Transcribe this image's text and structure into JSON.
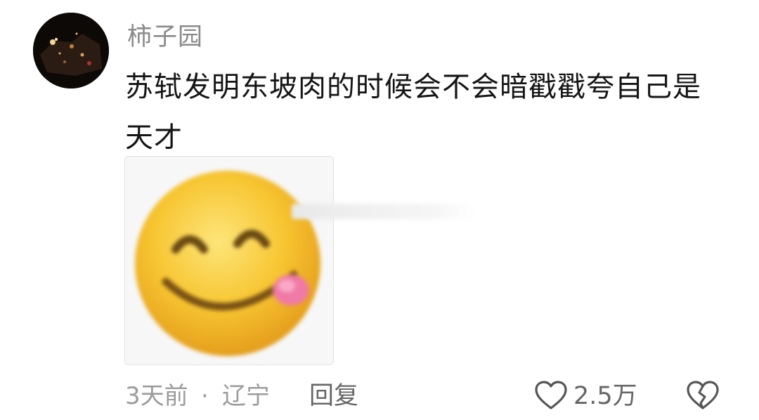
{
  "comment": {
    "username": "柿子园",
    "text": "苏轼发明东坡肉的时候会不会暗戳戳夸自己是天才",
    "sticker_icon": "tongue-out-smiley-emoji",
    "time": "3天前",
    "separator": "·",
    "location": "辽宁",
    "reply_label": "回复",
    "like_count": "2.5万",
    "like_icon": "heart-outline-icon",
    "dislike_icon": "broken-heart-icon"
  },
  "colors": {
    "username": "#8a8a8a",
    "text": "#151515",
    "meta": "#9b9b9b",
    "action": "#666666",
    "emoji_yellow": "#f7c531",
    "tongue_pink": "#f07aa5"
  }
}
